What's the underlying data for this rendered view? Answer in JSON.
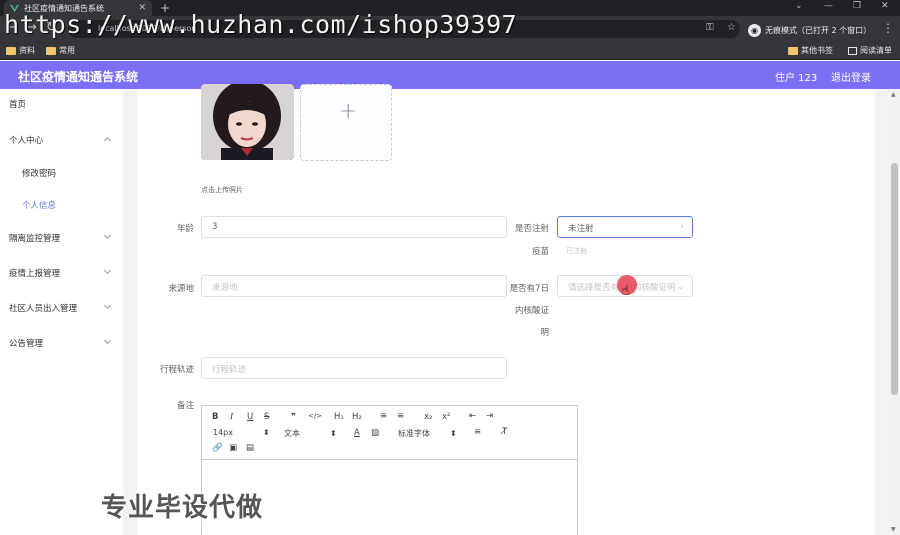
{
  "browser": {
    "tab_title": "社区疫情通知通告系统",
    "url": "localhost:8080/#/person",
    "incognito_label": "无痕模式（已打开 2 个窗口）",
    "bookmarks": [
      "资料",
      "常用"
    ],
    "bookmarks_right": [
      "其他书签",
      "阅读清单"
    ]
  },
  "watermark": "https://www.huzhan.com/ishop39397",
  "header": {
    "title": "社区疫情通知通告系统",
    "user": "住户 123",
    "logout": "退出登录",
    "color": "#7b70f5"
  },
  "sidebar": {
    "items": [
      {
        "label": "首页"
      },
      {
        "label": "个人中心"
      },
      {
        "label": "修改密码"
      },
      {
        "label": "个人信息"
      },
      {
        "label": "隔离监控管理"
      },
      {
        "label": "疫情上报管理"
      },
      {
        "label": "社区人员出入管理"
      },
      {
        "label": "公告管理"
      }
    ],
    "active_color": "#5e7ce0"
  },
  "form": {
    "upload_tip": "点击上传照片",
    "age_label": "年龄",
    "age_value": "3",
    "vaccinated_label_1": "是否注射",
    "vaccinated_label_2": "疫苗",
    "vaccinated_value": "未注射",
    "vaccinated_option_hint": "已注射",
    "origin_label": "来源地",
    "origin_placeholder": "来源地",
    "nucleic_label_1": "是否有7日",
    "nucleic_label_2": "内核酸证",
    "nucleic_label_3": "明",
    "nucleic_placeholder": "请选择是否有7日内核酸证明",
    "trip_label": "行程轨迹",
    "trip_placeholder": "行程轨迹",
    "remark_label": "备注"
  },
  "editor": {
    "buttons": [
      "B",
      "I",
      "U",
      "S",
      "❞",
      "</>",
      "H₁",
      "H₂",
      "≡",
      "≡",
      "x₂",
      "x²",
      "⇤",
      "⇥"
    ],
    "font_size": "14px",
    "text_type": "文本",
    "font_family": "标准字体"
  },
  "promo": "专业毕设代做"
}
